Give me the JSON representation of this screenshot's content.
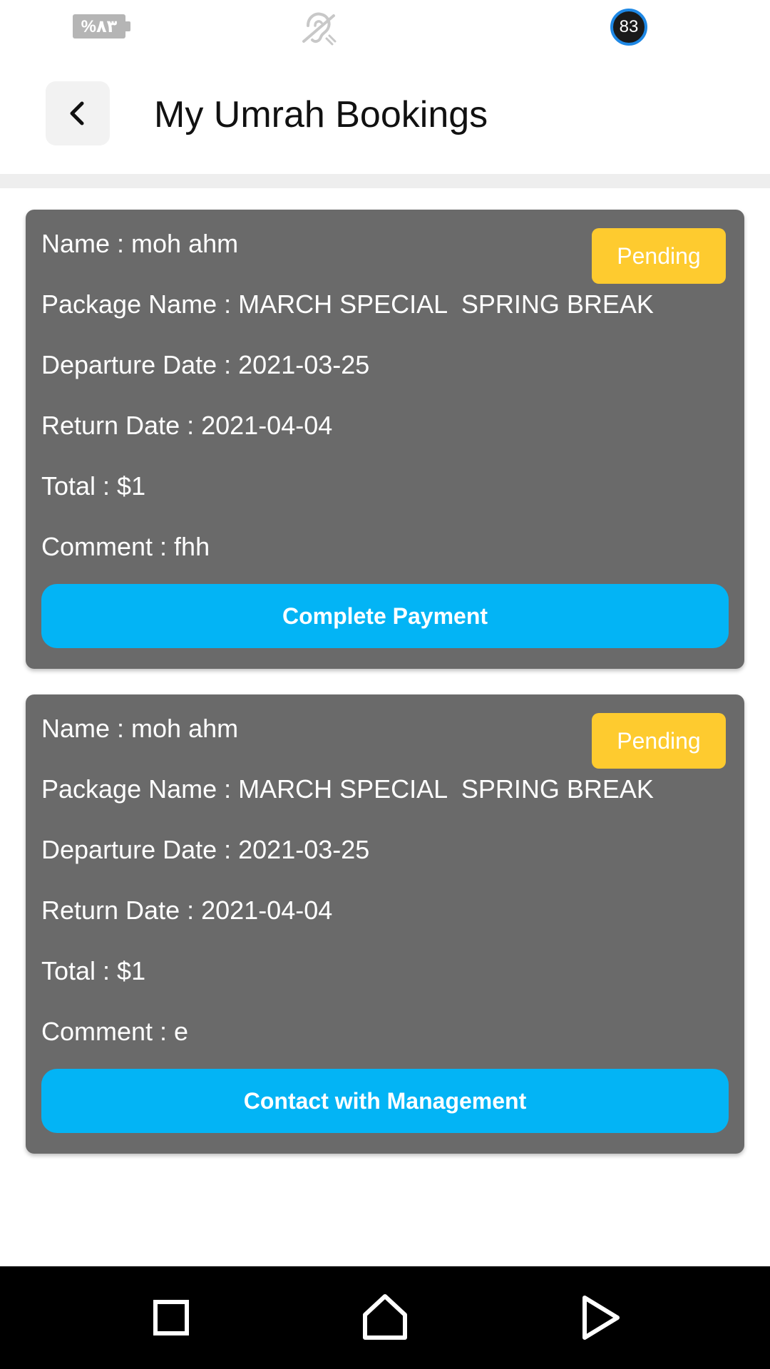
{
  "status_bar": {
    "battery_text": "%٨٣",
    "level_badge": "83",
    "icons": [
      "battery-icon",
      "hearing-icon",
      "level-badge-icon"
    ]
  },
  "header": {
    "back_icon": "chevron-left-icon",
    "title": "My Umrah Bookings"
  },
  "bookings": [
    {
      "name": "Name : moh ahm",
      "package": "Package Name : MARCH SPECIAL  SPRING BREAK",
      "departure": "Departure Date : 2021-03-25",
      "return_date": "Return Date : 2021-04-04",
      "total": "Total : $1",
      "comment": "Comment : fhh",
      "status": "Pending",
      "action_label": "Complete Payment"
    },
    {
      "name": "Name : moh ahm",
      "package": "Package Name : MARCH SPECIAL  SPRING BREAK",
      "departure": "Departure Date : 2021-03-25",
      "return_date": "Return Date : 2021-04-04",
      "total": "Total : $1",
      "comment": "Comment : e",
      "status": "Pending",
      "action_label": "Contact with Management"
    }
  ],
  "nav_bar": {
    "items": [
      "recent-apps-icon",
      "home-icon",
      "back-icon"
    ]
  },
  "colors": {
    "card_background": "#6a6a6a",
    "pending_badge": "#fecb2f",
    "action_button": "#03b4f5",
    "nav_bar": "#000000"
  }
}
